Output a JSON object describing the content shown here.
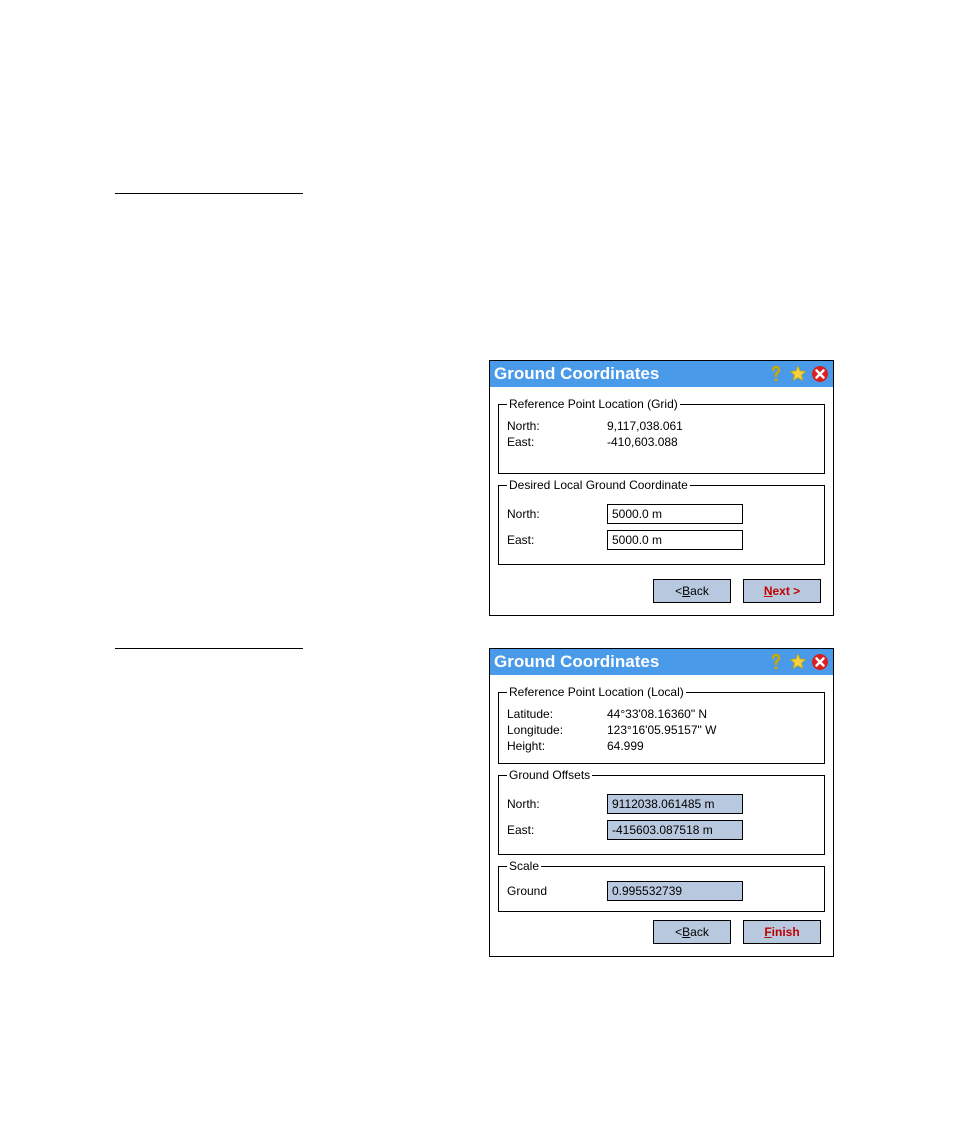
{
  "dialog1": {
    "title": "Ground Coordinates",
    "group1": {
      "legend": "Reference Point Location (Grid)",
      "north_label": "North:",
      "north_value": "9,117,038.061",
      "east_label": "East:",
      "east_value": "-410,603.088"
    },
    "group2": {
      "legend": "Desired Local Ground Coordinate",
      "north_label": "North:",
      "north_value": "5000.0 m",
      "east_label": "East:",
      "east_value": "5000.0 m"
    },
    "buttons": {
      "back_prefix": "< ",
      "back_u": "B",
      "back_suffix": "ack",
      "next_u": "N",
      "next_suffix": "ext >"
    }
  },
  "dialog2": {
    "title": "Ground Coordinates",
    "group1": {
      "legend": "Reference Point Location (Local)",
      "lat_label": "Latitude:",
      "lat_value": "44°33'08.16360\" N",
      "lon_label": "Longitude:",
      "lon_value": "123°16'05.95157\" W",
      "hgt_label": "Height:",
      "hgt_value": "64.999"
    },
    "group2": {
      "legend": "Ground Offsets",
      "north_label": "North:",
      "north_value": "9112038.061485 m",
      "east_label": "East:",
      "east_value": "-415603.087518 m"
    },
    "group3": {
      "legend": "Scale",
      "ground_label": "Ground",
      "ground_value": "0.995532739"
    },
    "buttons": {
      "back_prefix": "< ",
      "back_u": "B",
      "back_suffix": "ack",
      "finish_u": "F",
      "finish_suffix": "inish"
    }
  }
}
